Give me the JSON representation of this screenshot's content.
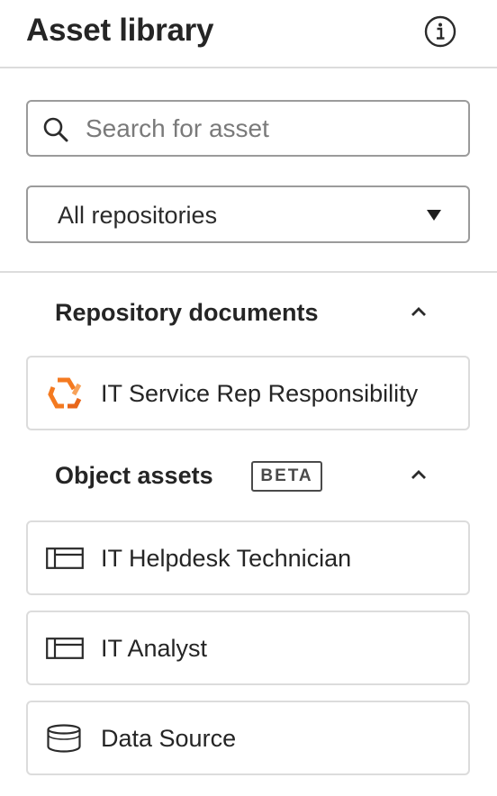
{
  "header": {
    "title": "Asset library",
    "info_icon": "info-circle-icon"
  },
  "search": {
    "placeholder": "Search for asset",
    "value": "",
    "icon": "search-icon"
  },
  "repository_select": {
    "selected": "All repositories",
    "icon": "caret-down-icon"
  },
  "sections": {
    "repository_documents": {
      "title": "Repository documents",
      "collapse_icon": "chevron-up-icon",
      "items": [
        {
          "label": "IT Service Rep Responsibility",
          "icon": "document-hexagon-icon",
          "icon_color": "#f47a20"
        }
      ]
    },
    "object_assets": {
      "title": "Object assets",
      "badge": "BETA",
      "collapse_icon": "chevron-up-icon",
      "items": [
        {
          "label": "IT Helpdesk Technician",
          "icon": "table-icon"
        },
        {
          "label": "IT Analyst",
          "icon": "table-icon"
        },
        {
          "label": "Data Source",
          "icon": "database-icon"
        }
      ]
    }
  }
}
